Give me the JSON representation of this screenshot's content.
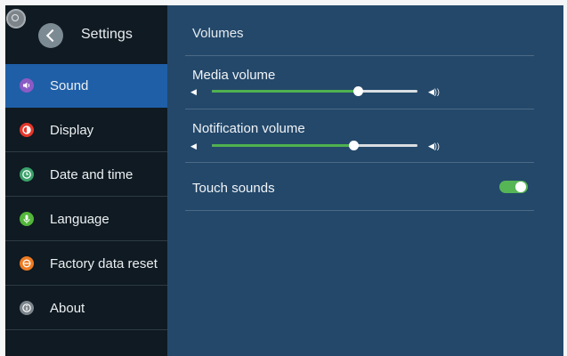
{
  "sidebar": {
    "title": "Settings",
    "items": [
      {
        "label": "Sound",
        "icon": "speaker-icon",
        "color": "#8b5bc4",
        "active": true
      },
      {
        "label": "Display",
        "icon": "display-icon",
        "color": "#e5372a",
        "active": false
      },
      {
        "label": "Date and time",
        "icon": "clock-icon",
        "color": "#3aa26a",
        "active": false
      },
      {
        "label": "Language",
        "icon": "microphone-icon",
        "color": "#53b63a",
        "active": false
      },
      {
        "label": "Factory data reset",
        "icon": "reset-icon",
        "color": "#ef7b22",
        "active": false
      },
      {
        "label": "About",
        "icon": "info-icon",
        "color": "#7d868c",
        "active": false
      }
    ]
  },
  "main": {
    "section_title": "Volumes",
    "media_volume": {
      "label": "Media volume",
      "value": 0.71
    },
    "notification_volume": {
      "label": "Notification volume",
      "value": 0.69
    },
    "touch_sounds": {
      "label": "Touch sounds",
      "enabled": true
    }
  },
  "colors": {
    "accent": "#4fb14f",
    "sidebar_active": "#1f5fa8",
    "panel": "#24486a"
  }
}
